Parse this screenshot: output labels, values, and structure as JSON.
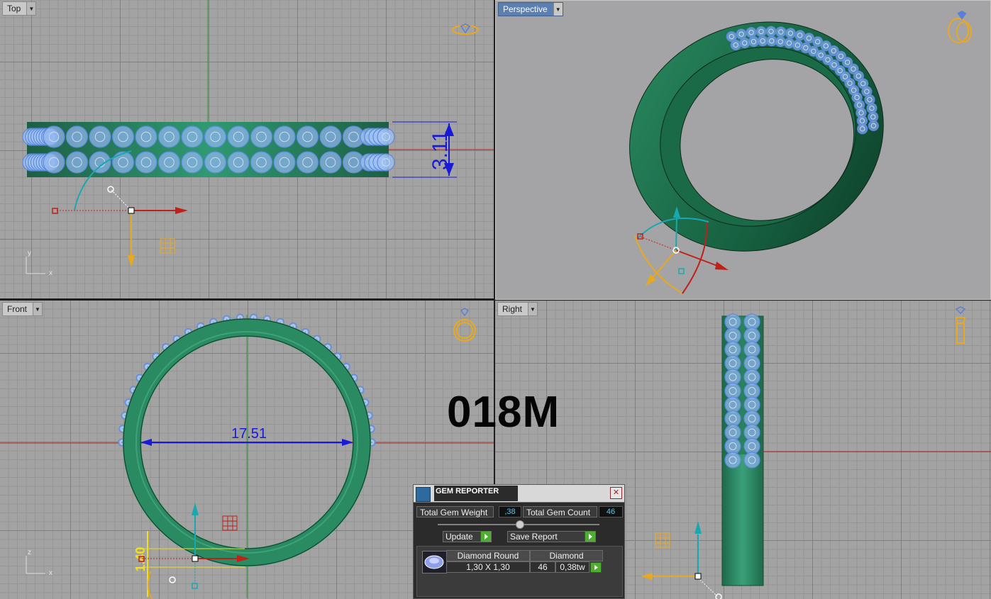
{
  "viewports": {
    "top": {
      "label": "Top",
      "dimension": "3.11",
      "axis_y": "y",
      "axis_x": "x"
    },
    "perspective": {
      "label": "Perspective"
    },
    "front": {
      "label": "Front",
      "dimension": "17.51",
      "small_dimension": "1.40",
      "axis_z": "z",
      "axis_x": "x"
    },
    "right": {
      "label": "Right"
    }
  },
  "overlay_text": "018M",
  "gem_reporter": {
    "title": "GEM REPORTER",
    "close_glyph": "✕",
    "total_weight_label": "Total Gem Weight",
    "total_weight_value": ",38",
    "total_count_label": "Total Gem Count",
    "total_count_value": "46",
    "update_label": "Update",
    "save_report_label": "Save Report",
    "table": {
      "header_cut": "Diamond Round",
      "header_material": "Diamond",
      "size": "1,30 X 1,30",
      "count": "46",
      "weight": "0,38tw"
    }
  },
  "colors": {
    "ring": "#1f7a55",
    "gem": "#8fb4ec",
    "x_axis": "#c0201a",
    "y_axis": "#2e9a2e",
    "dimension": "#1919d8",
    "viewport_bg": "#a3a3a3",
    "gizmo_cyan": "#1aa8b0",
    "gizmo_orange": "#e8a820"
  },
  "icons": [
    "ring-icon",
    "gem-reporter-icon",
    "close-icon",
    "dropdown-arrow-icon",
    "play-icon"
  ]
}
